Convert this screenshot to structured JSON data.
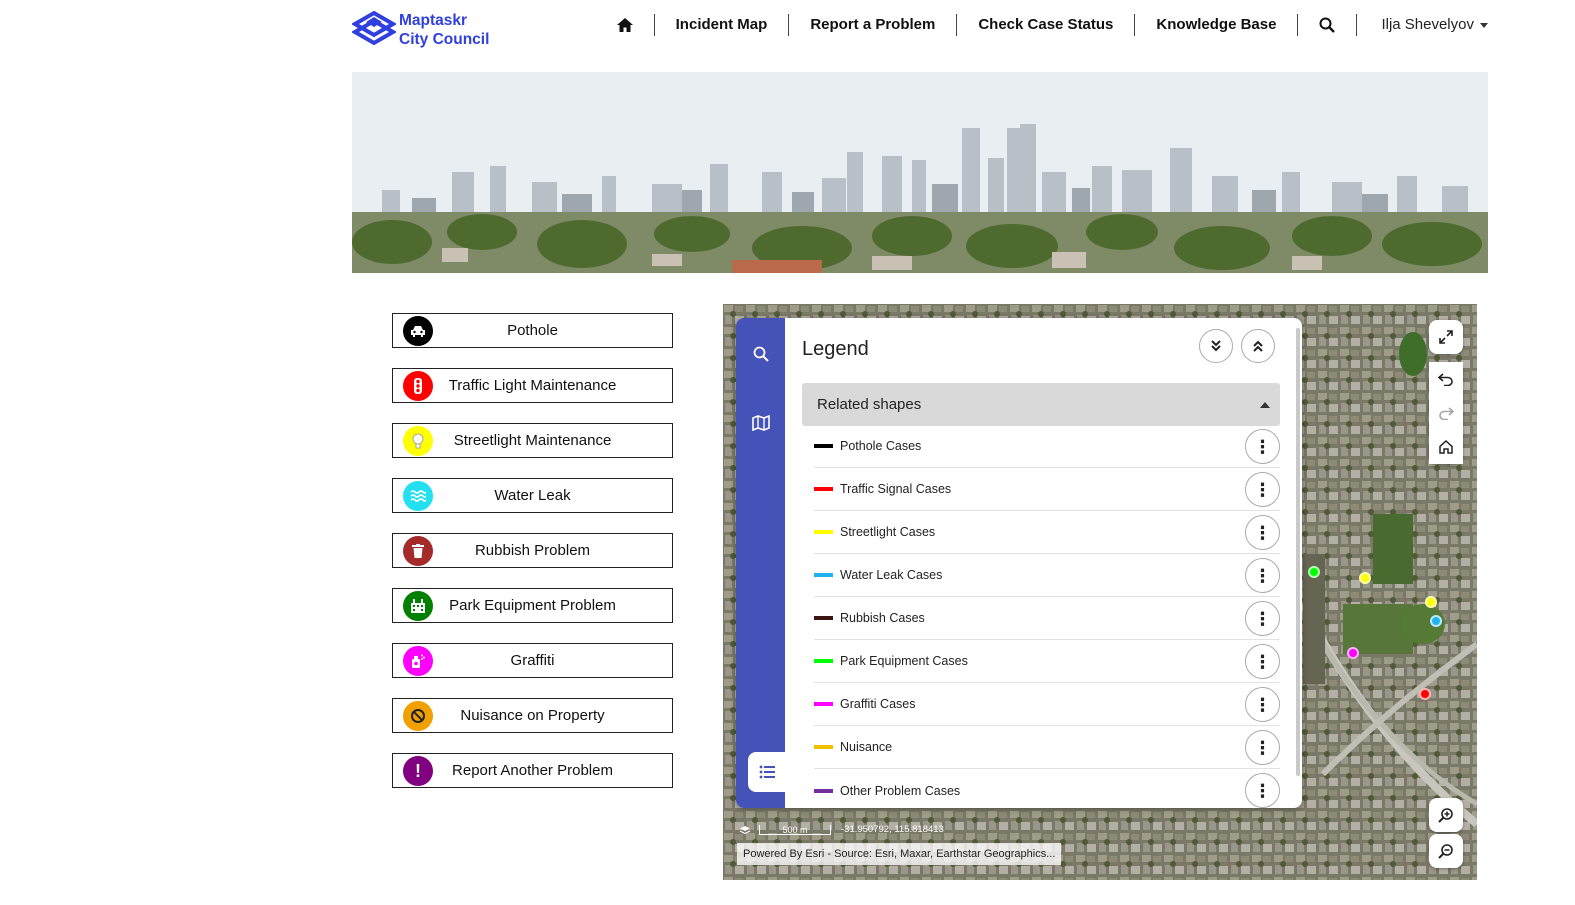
{
  "brand": {
    "line1": "Maptaskr",
    "line2": "City Council",
    "color": "#2f3fe0"
  },
  "nav": {
    "home_icon": "home-icon",
    "items": [
      "Incident Map",
      "Report a Problem",
      "Check Case Status",
      "Knowledge Base"
    ],
    "search_icon": "search-icon",
    "user": "Ilja Shevelyov"
  },
  "problems": [
    {
      "label": "Pothole",
      "icon": "car-icon",
      "color": "#000000"
    },
    {
      "label": "Traffic Light Maintenance",
      "icon": "traffic-light-icon",
      "color": "#ff0000"
    },
    {
      "label": "Streetlight Maintenance",
      "icon": "lightbulb-icon",
      "color": "#ffff00"
    },
    {
      "label": "Water Leak",
      "icon": "water-icon",
      "color": "#22e0f0"
    },
    {
      "label": "Rubbish Problem",
      "icon": "trash-icon",
      "color": "#a52a2a"
    },
    {
      "label": "Park Equipment Problem",
      "icon": "park-icon",
      "color": "#008000"
    },
    {
      "label": "Graffiti",
      "icon": "spray-can-icon",
      "color": "#ff00ff"
    },
    {
      "label": "Nuisance on Property",
      "icon": "ban-icon",
      "color": "#f0a000"
    },
    {
      "label": "Report Another Problem",
      "icon": "exclamation-icon",
      "color": "#800080"
    }
  ],
  "legend": {
    "title": "Legend",
    "group": "Related shapes",
    "items": [
      {
        "label": "Pothole Cases",
        "color": "#000000"
      },
      {
        "label": "Traffic Signal Cases",
        "color": "#ff0000"
      },
      {
        "label": "Streetlight Cases",
        "color": "#ffff00"
      },
      {
        "label": "Water Leak Cases",
        "color": "#1eb4f0"
      },
      {
        "label": "Rubbish Cases",
        "color": "#3c1414"
      },
      {
        "label": "Park Equipment Cases",
        "color": "#00ff00"
      },
      {
        "label": "Graffiti Cases",
        "color": "#ff00ff"
      },
      {
        "label": "Nuisance",
        "color": "#f0c000"
      },
      {
        "label": "Other Problem Cases",
        "color": "#7030a0"
      }
    ]
  },
  "map": {
    "scale": "500 m",
    "coordinates": "-31.950792, 115.818413",
    "attribution": "Powered By Esri - Source: Esri, Maxar, Earthstar Geographics..."
  }
}
